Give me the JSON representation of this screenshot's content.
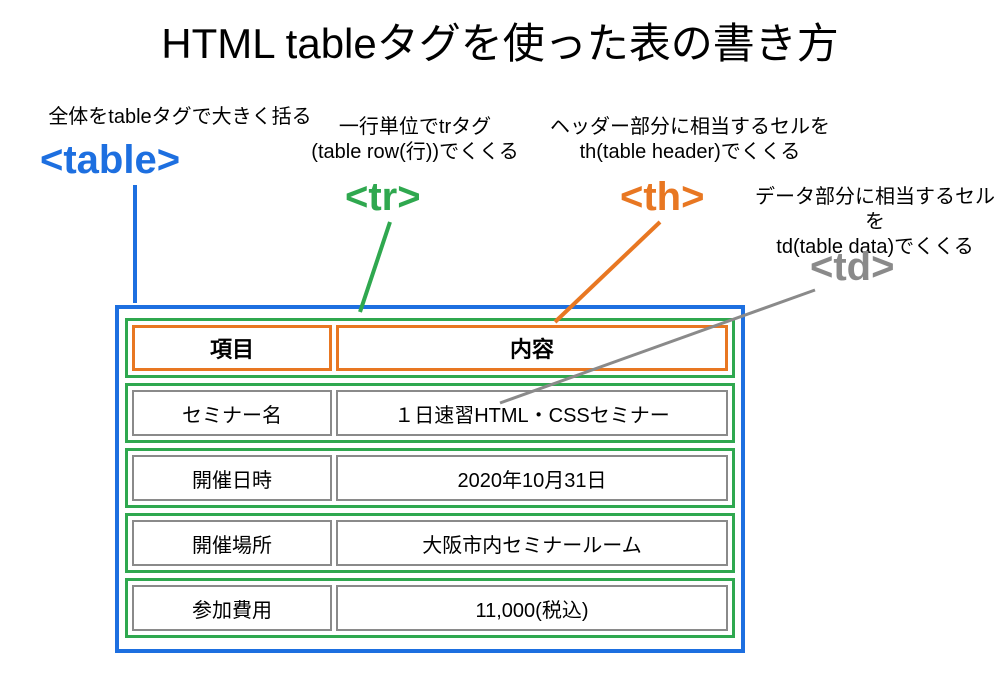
{
  "title": "HTML tableタグを使った表の書き方",
  "anno": {
    "table": {
      "text": "全体をtableタグで大きく括る",
      "tag": "<table>"
    },
    "tr": {
      "text": "一行単位でtrタグ\n(table row(行))でくくる",
      "tag": "<tr>"
    },
    "th": {
      "text": "ヘッダー部分に相当するセルを\nth(table header)でくくる",
      "tag": "<th>"
    },
    "td": {
      "text": "データ部分に相当するセルを\ntd(table data)でくくる",
      "tag": "<td>"
    }
  },
  "headers": {
    "left": "項目",
    "right": "内容"
  },
  "rows": [
    {
      "left": "セミナー名",
      "right": "１日速習HTML・CSSセミナー"
    },
    {
      "left": "開催日時",
      "right": "2020年10月31日"
    },
    {
      "left": "開催場所",
      "right": "大阪市内セミナールーム"
    },
    {
      "left": "参加費用",
      "right": "11,000(税込)"
    }
  ],
  "colors": {
    "blue": "#1d6fe0",
    "green": "#2fa84f",
    "orange": "#e87722",
    "gray": "#8a8a8a"
  }
}
